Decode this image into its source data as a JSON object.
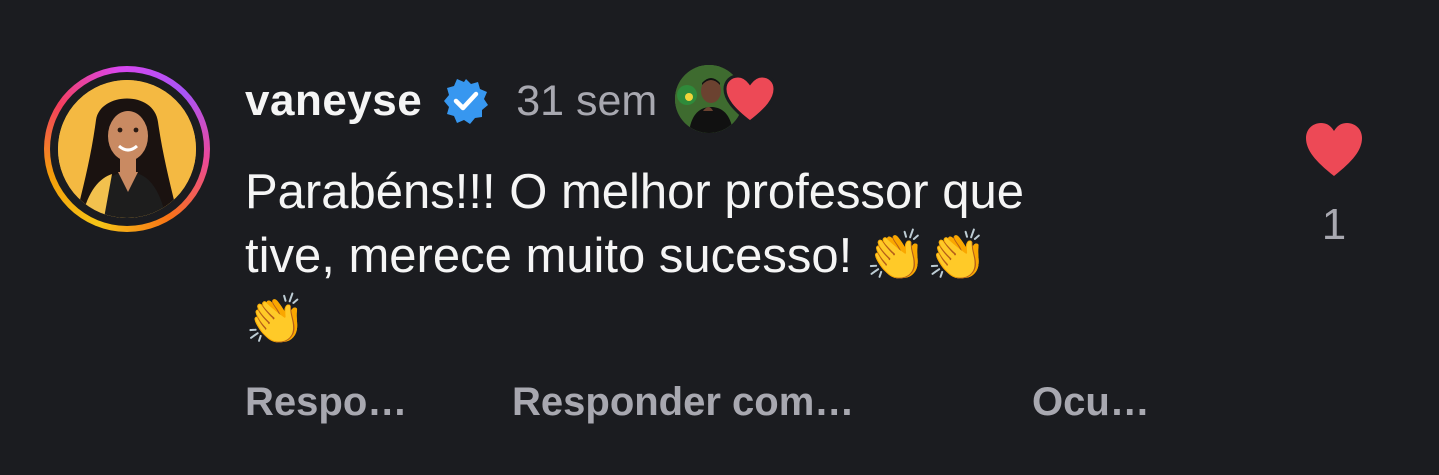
{
  "comment": {
    "username": "vaneyse",
    "timestamp": "31 sem",
    "text_line1": "Parabéns!!! O melhor professor que",
    "text_line2": "tive, merece muito sucesso! 👏👏",
    "text_line3": "👏",
    "like_count": "1"
  },
  "actions": {
    "reply_label": "Respo…",
    "reply_with_label": "Responder com…",
    "hide_label": "Ocu…"
  },
  "colors": {
    "background": "#1b1c20",
    "verified_badge": "#3797f0",
    "heart": "#ed4956",
    "muted_text": "#a8a8b0"
  },
  "icons": {
    "verified": "verified-badge-icon",
    "creator_heart": "heart-icon",
    "like": "heart-icon"
  }
}
